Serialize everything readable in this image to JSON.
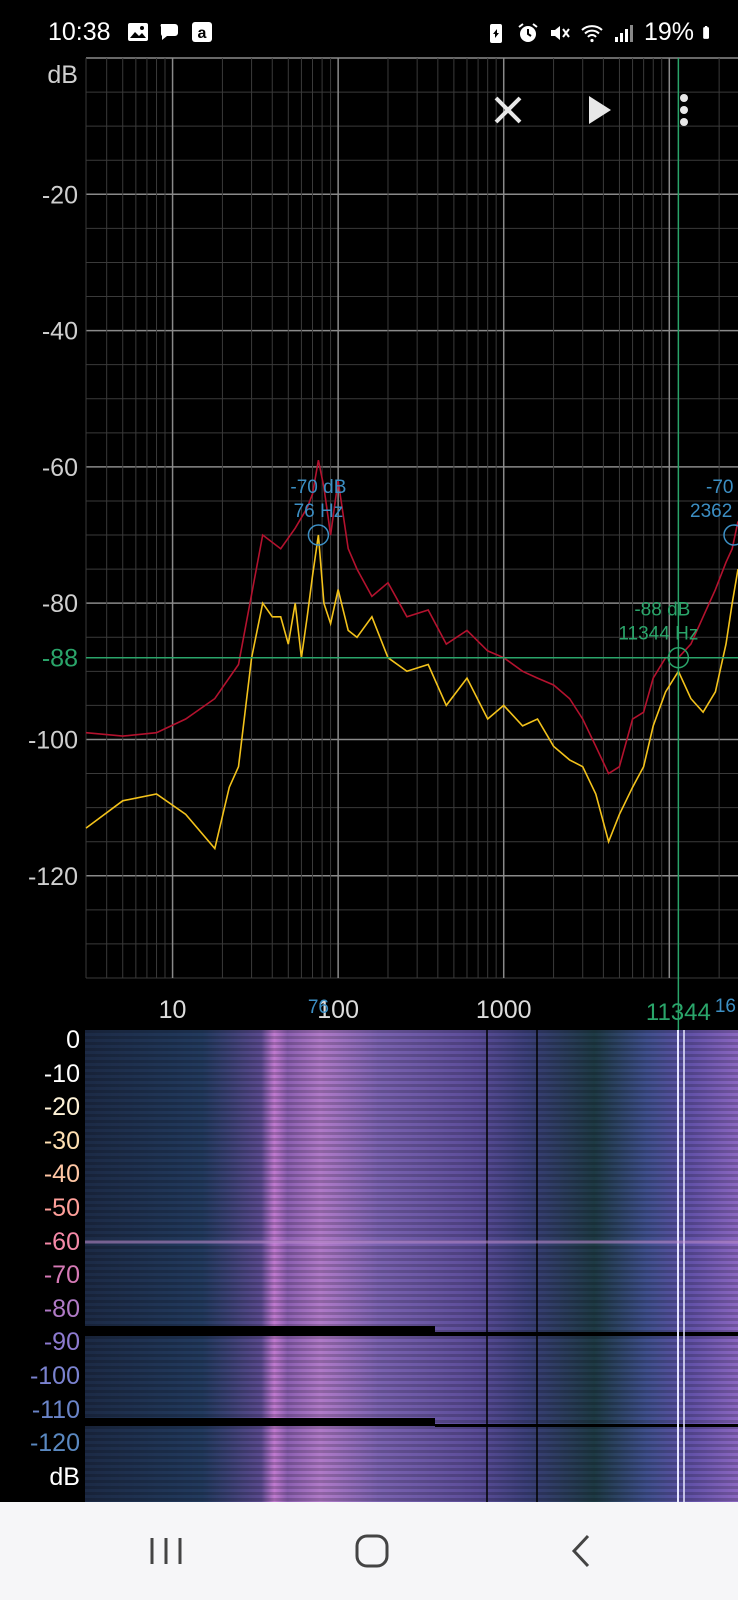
{
  "status_bar": {
    "time": "10:38",
    "battery_percent": "19%",
    "left_icons": [
      "gallery-icon",
      "chat-icon",
      "app-a-icon"
    ],
    "right_icons": [
      "battery-saver-icon",
      "alarm-icon",
      "mute-icon",
      "wifi-icon",
      "signal-icon",
      "battery-icon"
    ]
  },
  "toolbar": {
    "close_icon": "close-icon",
    "play_icon": "play-icon",
    "menu_icon": "more-vert-icon"
  },
  "spectrum": {
    "y_unit": "dB",
    "y_ticks": [
      "-20",
      "-40",
      "-60",
      "-80",
      "-100",
      "-120"
    ],
    "x_ticks": [
      "10",
      "100",
      "1000"
    ],
    "cursor_db_label": "-88",
    "marker1": {
      "db": "-70 dB",
      "hz": "76 Hz",
      "axis_label": "76"
    },
    "marker2": {
      "db": "-70",
      "hz": "2362"
    },
    "cursor": {
      "db": "-88 dB",
      "hz": "11344 Hz",
      "axis_label": "11344"
    },
    "right_axis_label": "16",
    "colors": {
      "peak_trace": "#b3122e",
      "live_trace": "#f3c21b",
      "cursor": "#2aa56a",
      "marker": "#3c8fc4",
      "grid": "#4a4a4a"
    }
  },
  "chart_data": {
    "type": "line",
    "xscale": "log",
    "xlim": [
      3,
      26000
    ],
    "ylim": [
      -135,
      0
    ],
    "y_ticks": [
      -20,
      -40,
      -60,
      -80,
      -100,
      -120
    ],
    "x_ticks": [
      10,
      100,
      1000
    ],
    "grid": true,
    "series": [
      {
        "x": [
          3,
          5,
          8,
          12,
          18,
          25,
          35,
          45,
          55,
          65,
          70,
          76,
          82,
          90,
          100,
          115,
          130,
          160,
          200,
          260,
          350,
          450,
          600,
          800,
          1000,
          1300,
          1600,
          2000,
          2500,
          3000,
          3600,
          4300,
          5000,
          6000,
          7000,
          8000,
          9500,
          11344,
          13500,
          16000,
          19000,
          22000,
          24000,
          26000
        ],
        "y": [
          -99,
          -99.5,
          -99,
          -97,
          -94,
          -89,
          -70,
          -72,
          -69,
          -66,
          -64,
          -59,
          -63,
          -70,
          -62,
          -72,
          -75,
          -79,
          -77,
          -82,
          -81,
          -86,
          -84,
          -87,
          -88,
          -90,
          -91,
          -92,
          -94,
          -97,
          -101,
          -105,
          -104,
          -97,
          -96,
          -91,
          -88,
          -88,
          -86,
          -82,
          -78,
          -74,
          -72,
          -68
        ]
      },
      {
        "x": [
          3,
          5,
          8,
          12,
          18,
          22,
          25,
          30,
          35,
          40,
          45,
          50,
          55,
          60,
          65,
          70,
          76,
          82,
          90,
          100,
          115,
          130,
          160,
          200,
          260,
          350,
          450,
          600,
          800,
          1000,
          1300,
          1600,
          2000,
          2500,
          3000,
          3600,
          4300,
          5000,
          6000,
          7000,
          8000,
          9500,
          11344,
          13500,
          16000,
          19000,
          22000,
          24000,
          26000
        ],
        "y": [
          -113,
          -109,
          -108,
          -111,
          -116,
          -107,
          -104,
          -88,
          -80,
          -82,
          -82,
          -86,
          -80,
          -88,
          -82,
          -76,
          -70,
          -80,
          -83,
          -78,
          -84,
          -85,
          -82,
          -88,
          -90,
          -89,
          -95,
          -91,
          -97,
          -95,
          -98,
          -97,
          -101,
          -103,
          -104,
          -108,
          -115,
          -111,
          -107,
          -104,
          -98,
          -93,
          -90,
          -94,
          -96,
          -93,
          -86,
          -80,
          -75
        ]
      }
    ]
  },
  "spectrogram": {
    "labels": [
      "0",
      "-10",
      "-20",
      "-30",
      "-40",
      "-50",
      "-60",
      "-70",
      "-80",
      "-90",
      "-100",
      "-110",
      "-120",
      "dB"
    ],
    "label_colors": [
      "#ffffff",
      "#ffffff",
      "#fff3d8",
      "#ffe0b2",
      "#ffc6a4",
      "#ff9f9a",
      "#f589a8",
      "#d67ab6",
      "#b07ac6",
      "#8d7ad0",
      "#7a82cf",
      "#6a84c8",
      "#5a88c0",
      "#ffffff"
    ]
  },
  "navbar": {
    "recent_icon": "recent-apps-icon",
    "home_icon": "home-icon",
    "back_icon": "back-icon"
  }
}
